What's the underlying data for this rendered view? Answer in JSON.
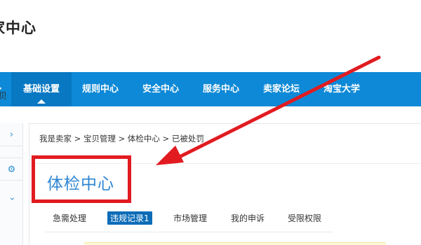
{
  "header": {
    "title": "家中心"
  },
  "nav": {
    "items": [
      {
        "label": "基础设置"
      },
      {
        "label": "规则中心"
      },
      {
        "label": "安全中心"
      },
      {
        "label": "服务中心"
      },
      {
        "label": "卖家论坛"
      },
      {
        "label": "淘宝大学"
      }
    ]
  },
  "sidebar": {
    "partial_label": "贝"
  },
  "breadcrumb": {
    "text": "我是卖家 > 宝贝管理 > 体检中心 > 已被处罚"
  },
  "page": {
    "title": "体检中心"
  },
  "tabs": [
    {
      "label": "急需处理"
    },
    {
      "label": "违规记录1"
    },
    {
      "label": "市场管理"
    },
    {
      "label": "我的申诉"
    },
    {
      "label": "受限权限"
    }
  ],
  "colors": {
    "nav_bg": "#0d89d7",
    "title_blue": "#2f86d3",
    "annotation_red": "#e11b20"
  }
}
